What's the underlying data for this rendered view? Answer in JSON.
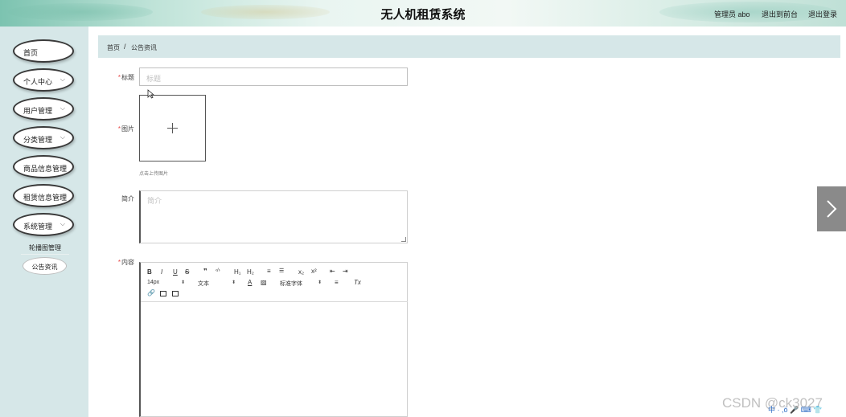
{
  "header": {
    "title": "无人机租赁系统",
    "user": "管理员 abo",
    "front_link": "退出到前台",
    "logout_link": "退出登录"
  },
  "sidebar": {
    "items": [
      {
        "label": "首页"
      },
      {
        "label": "个人中心"
      },
      {
        "label": "用户管理"
      },
      {
        "label": "分类管理"
      },
      {
        "label": "商品信息管理"
      },
      {
        "label": "租赁信息管理"
      },
      {
        "label": "系统管理"
      }
    ],
    "subitems": [
      {
        "label": "轮播图管理"
      },
      {
        "label": "公告资讯"
      }
    ]
  },
  "breadcrumb": {
    "home": "首页",
    "separator": "/",
    "current": "公告资讯"
  },
  "form": {
    "title_label": "标题",
    "title_placeholder": "标题",
    "image_label": "图片",
    "image_hint": "点击上传图片",
    "intro_label": "简介",
    "intro_placeholder": "简介",
    "content_label": "内容",
    "required_mark": "*"
  },
  "editor": {
    "font_size": "14px",
    "block_type": "文本",
    "font_family": "标准字体",
    "buttons": {
      "bold": "B",
      "italic": "I",
      "underline": "U",
      "strike": "S",
      "blockquote": "❞",
      "code": "‹/›",
      "h1": "H₁",
      "h2": "H₂",
      "ordered_list": "≡",
      "bullet_list": "☰",
      "subscript": "x₂",
      "superscript": "x²",
      "outdent": "⇤",
      "indent": "⇥",
      "color": "A",
      "background": "▨",
      "align": "≡",
      "clean": "Tx"
    }
  },
  "watermark": "CSDN @ck3027",
  "ime": "中 · ,ö 🎤 ⌨ 👕"
}
